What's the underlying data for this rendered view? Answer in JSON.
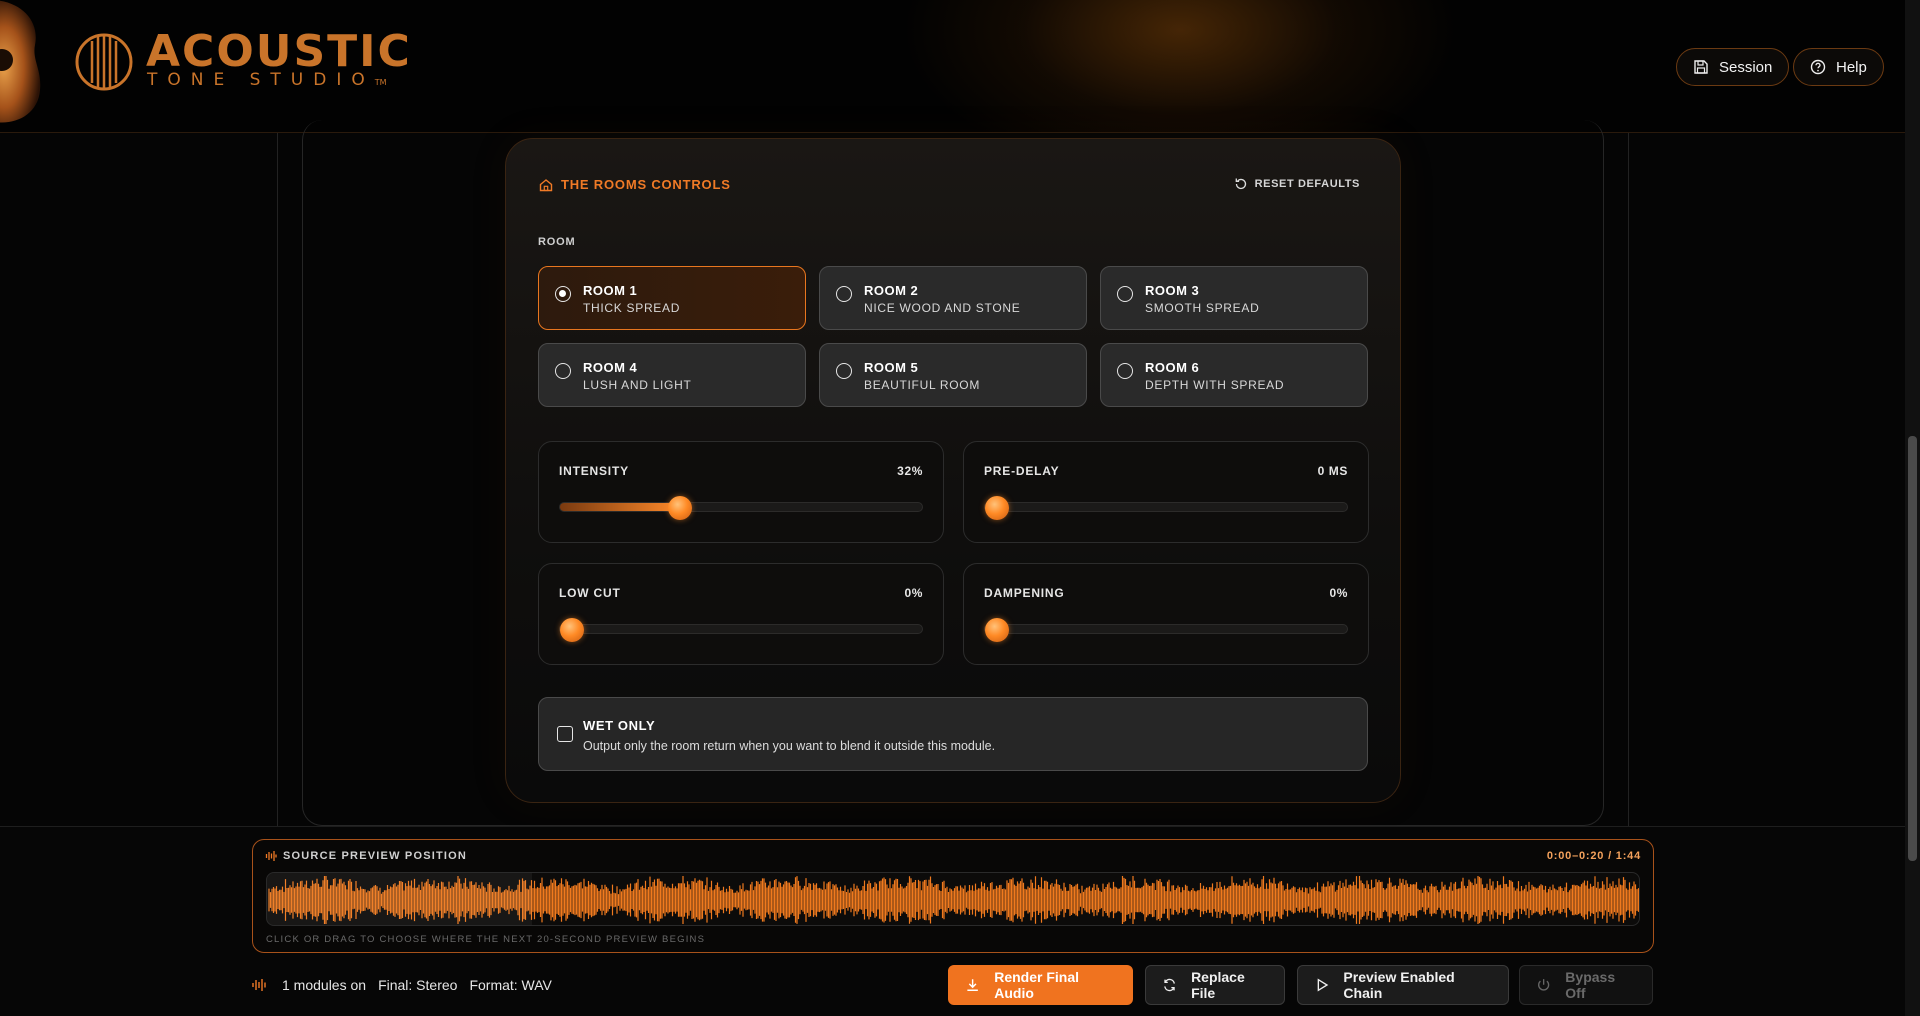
{
  "brand": {
    "title": "ACOUSTIC",
    "subtitle": "TONE STUDIO",
    "trademark": "TM",
    "accent": "#f0731f"
  },
  "header": {
    "session_label": "Session",
    "help_label": "Help"
  },
  "rooms_card": {
    "title": "THE ROOMS CONTROLS",
    "reset_label": "RESET DEFAULTS",
    "section_label": "ROOM",
    "selected": "ROOM 1",
    "rooms": [
      {
        "name": "ROOM 1",
        "desc": "THICK SPREAD"
      },
      {
        "name": "ROOM 2",
        "desc": "NICE WOOD AND STONE"
      },
      {
        "name": "ROOM 3",
        "desc": "SMOOTH SPREAD"
      },
      {
        "name": "ROOM 4",
        "desc": "LUSH AND LIGHT"
      },
      {
        "name": "ROOM 5",
        "desc": "BEAUTIFUL ROOM"
      },
      {
        "name": "ROOM 6",
        "desc": "DEPTH WITH SPREAD"
      }
    ],
    "sliders": [
      {
        "label": "INTENSITY",
        "value_text": "32%",
        "level": 0.32
      },
      {
        "label": "PRE-DELAY",
        "value_text": "0 MS",
        "level": 0
      },
      {
        "label": "LOW CUT",
        "value_text": "0%",
        "level": 0
      },
      {
        "label": "DAMPENING",
        "value_text": "0%",
        "level": 0
      }
    ],
    "wet_only": {
      "title": "WET ONLY",
      "desc": "Output only the room return when you want to blend it outside this module.",
      "checked": false
    }
  },
  "preview": {
    "title": "SOURCE PREVIEW POSITION",
    "time": "0:00–0:20 / 1:44",
    "hint": "CLICK OR DRAG TO CHOOSE WHERE THE NEXT 20-SECOND PREVIEW BEGINS",
    "waveform_color": "#f07a1e"
  },
  "status": {
    "modules": "1 modules on",
    "final": "Final: Stereo",
    "format": "Format: WAV"
  },
  "actions": {
    "render": "Render Final Audio",
    "replace": "Replace File",
    "preview_chain": "Preview Enabled Chain",
    "bypass": "Bypass Off"
  }
}
